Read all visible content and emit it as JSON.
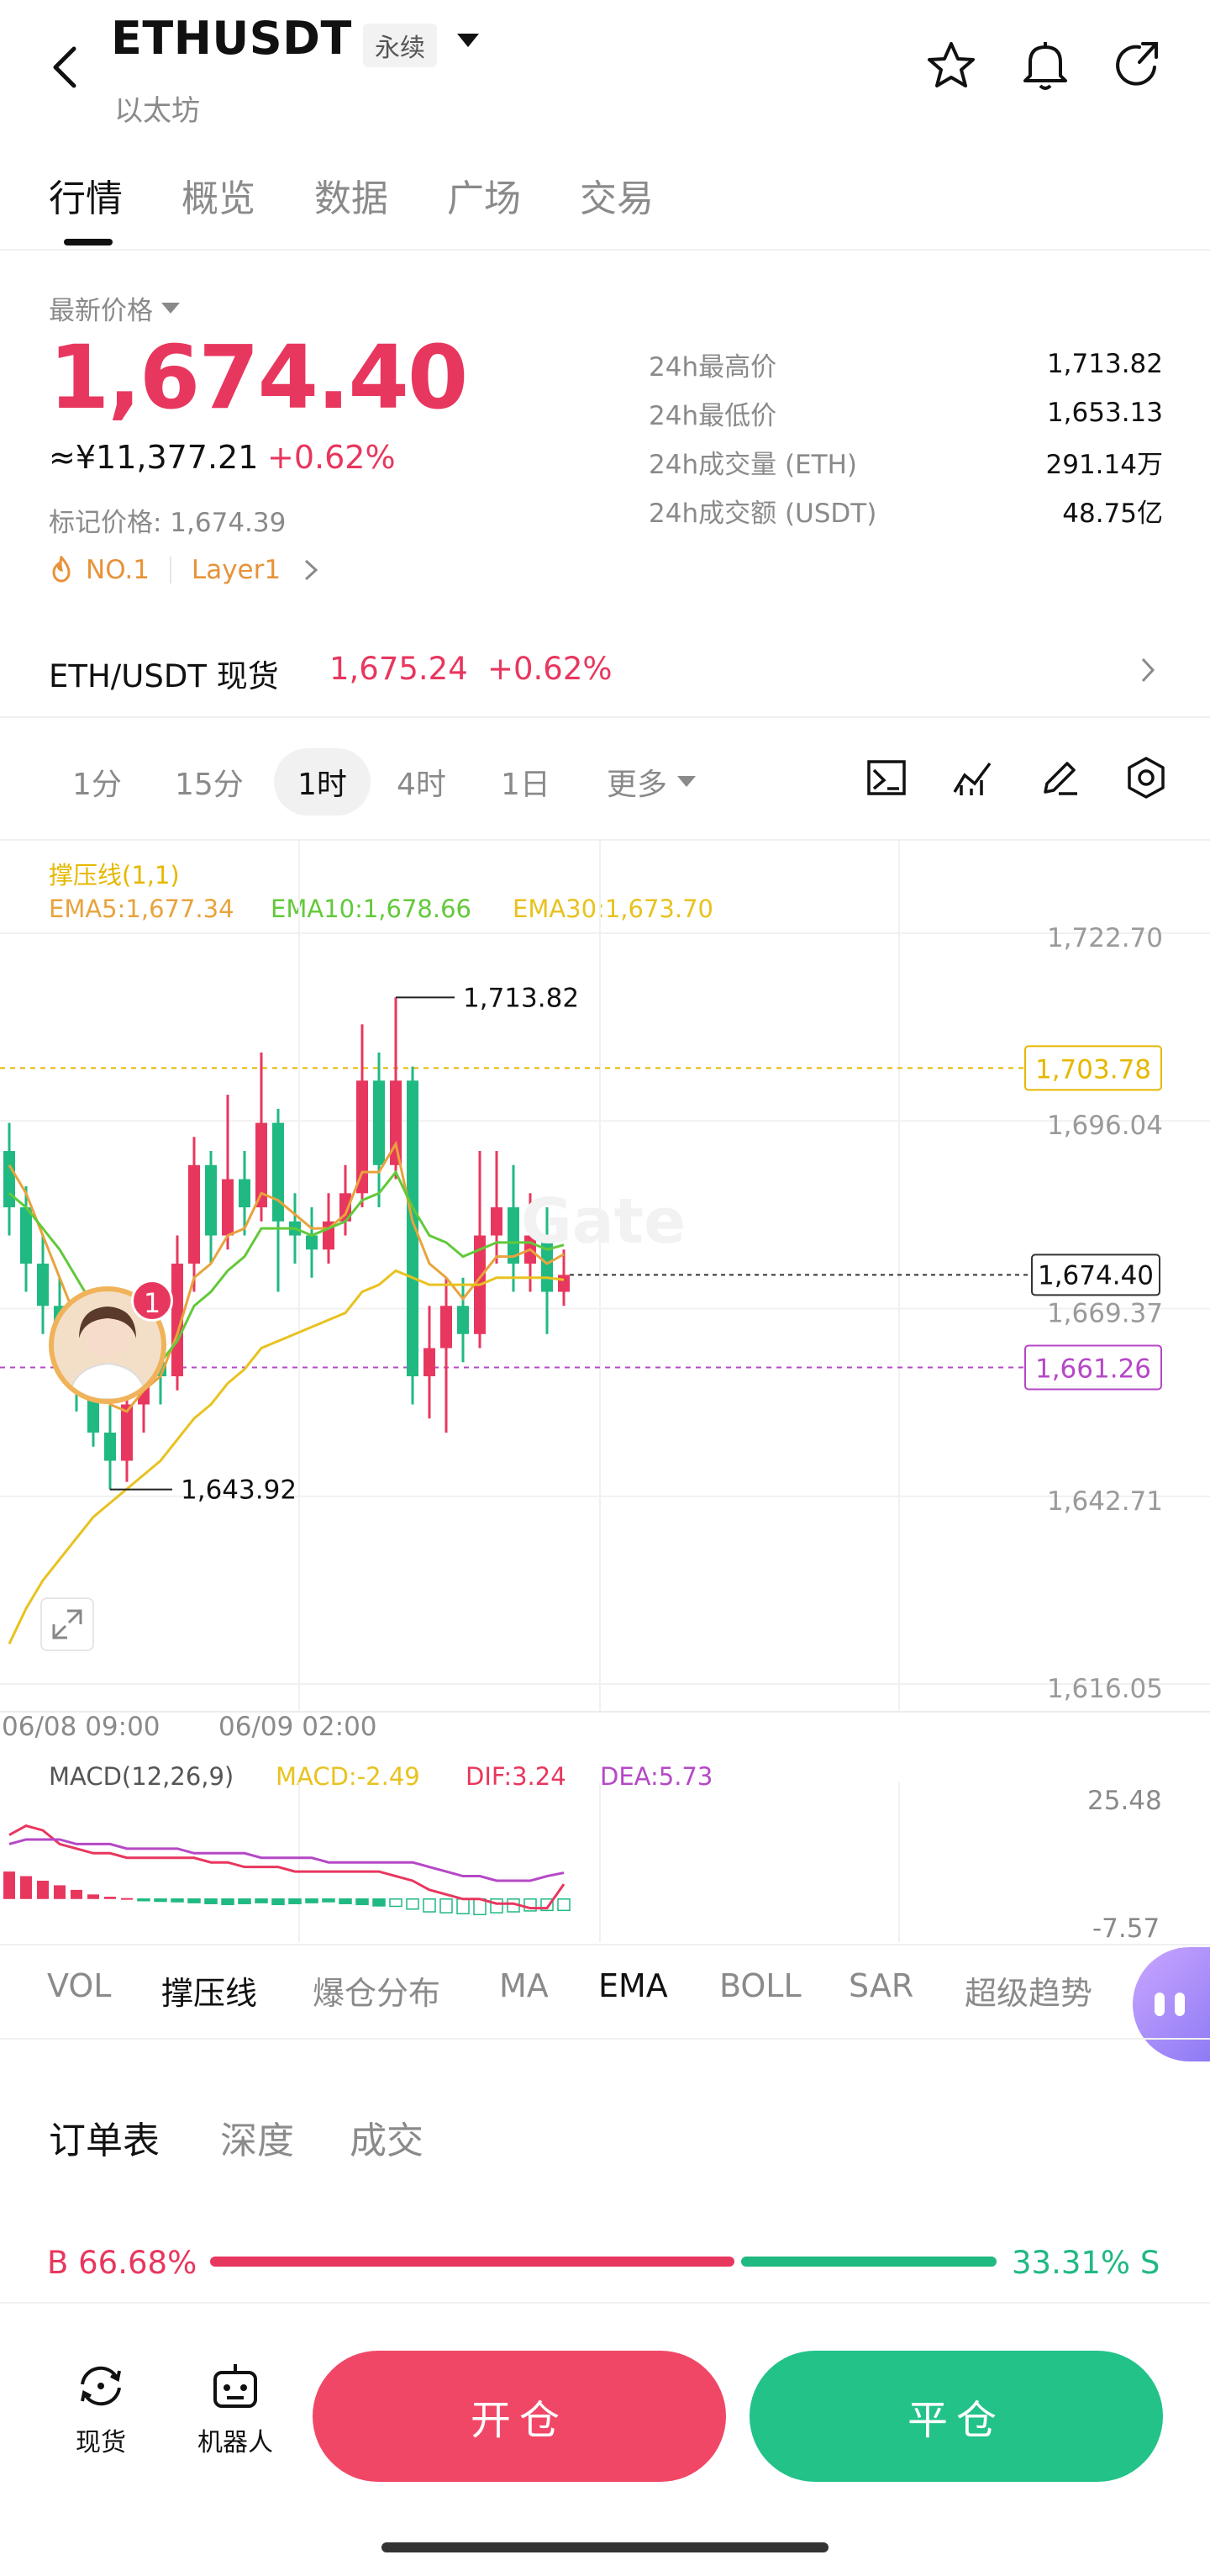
{
  "header": {
    "symbol": "ETHUSDT",
    "contract_tag": "永续",
    "subtitle": "以太坊"
  },
  "tabs": [
    {
      "label": "行情",
      "active": true
    },
    {
      "label": "概览",
      "active": false
    },
    {
      "label": "数据",
      "active": false
    },
    {
      "label": "广场",
      "active": false
    },
    {
      "label": "交易",
      "active": false
    }
  ],
  "price": {
    "label": "最新价格",
    "last": "1,674.40",
    "cny": "≈¥11,377.21",
    "change": "+0.62%",
    "mark_price": "标记价格: 1,674.39",
    "badge_rank": "NO.1",
    "badge_category": "Layer1"
  },
  "stats": [
    {
      "label": "24h最高价",
      "value": "1,713.82"
    },
    {
      "label": "24h最低价",
      "value": "1,653.13"
    },
    {
      "label": "24h成交量 (ETH)",
      "value": "291.14万"
    },
    {
      "label": "24h成交额 (USDT)",
      "value": "48.75亿"
    }
  ],
  "spot": {
    "pair": "ETH/USDT 现货",
    "price": "1,675.24",
    "change": "+0.62%"
  },
  "intervals": [
    {
      "label": "1分",
      "active": false
    },
    {
      "label": "15分",
      "active": false
    },
    {
      "label": "1时",
      "active": true
    },
    {
      "label": "4时",
      "active": false
    },
    {
      "label": "1日",
      "active": false
    },
    {
      "label": "更多",
      "active": false
    }
  ],
  "indicators_legend": {
    "support_line": "撑压线(1,1)",
    "ema5": "EMA5:1,677.34",
    "ema10": "EMA10:1,678.66",
    "ema30": "EMA30:1,673.70"
  },
  "colors": {
    "up": "#e8375e",
    "down": "#20b982",
    "ema5": "#e8a33d",
    "ema10": "#62c93a",
    "ema30": "#e8c21f",
    "support": "#e8a33d",
    "resistance_label": "#e6b800",
    "purple": "#b548c6"
  },
  "chart_data": {
    "type": "line",
    "title": "",
    "y_ticks": [
      "1,722.70",
      "1,696.04",
      "1,669.37",
      "1,642.71",
      "1,616.05"
    ],
    "ylim": [
      1616.05,
      1722.7
    ],
    "x_ticks": [
      "06/08 09:00",
      "06/09 02:00"
    ],
    "annotations": {
      "high": "1,713.82",
      "low": "1,643.92",
      "last": "1,674.40",
      "resistance": "1,703.78",
      "support": "1,661.26"
    },
    "candles": [
      [
        1692,
        1684,
        1696,
        1680
      ],
      [
        1684,
        1676,
        1687,
        1672
      ],
      [
        1676,
        1670,
        1680,
        1666
      ],
      [
        1670,
        1664,
        1674,
        1660
      ],
      [
        1664,
        1660,
        1668,
        1655
      ],
      [
        1660,
        1652,
        1664,
        1650
      ],
      [
        1652,
        1648,
        1656,
        1644
      ],
      [
        1648,
        1656,
        1660,
        1645
      ],
      [
        1656,
        1662,
        1665,
        1652
      ],
      [
        1662,
        1660,
        1666,
        1656
      ],
      [
        1660,
        1676,
        1680,
        1658
      ],
      [
        1676,
        1690,
        1694,
        1672
      ],
      [
        1690,
        1680,
        1692,
        1676
      ],
      [
        1680,
        1688,
        1700,
        1678
      ],
      [
        1688,
        1684,
        1692,
        1680
      ],
      [
        1684,
        1696,
        1706,
        1682
      ],
      [
        1696,
        1682,
        1698,
        1672
      ],
      [
        1682,
        1680,
        1686,
        1676
      ],
      [
        1680,
        1678,
        1684,
        1674
      ],
      [
        1678,
        1682,
        1686,
        1676
      ],
      [
        1682,
        1686,
        1690,
        1680
      ],
      [
        1686,
        1702,
        1710,
        1684
      ],
      [
        1702,
        1690,
        1706,
        1684
      ],
      [
        1690,
        1702,
        1713.82,
        1688
      ],
      [
        1702,
        1660,
        1704,
        1656
      ],
      [
        1660,
        1664,
        1670,
        1654
      ],
      [
        1664,
        1670,
        1674,
        1652
      ],
      [
        1670,
        1666,
        1674,
        1662
      ],
      [
        1666,
        1680,
        1692,
        1664
      ],
      [
        1680,
        1684,
        1692,
        1676
      ],
      [
        1684,
        1676,
        1690,
        1672
      ],
      [
        1676,
        1680,
        1686,
        1672
      ],
      [
        1680,
        1672,
        1684,
        1666
      ],
      [
        1672,
        1674.4,
        1678,
        1670
      ]
    ],
    "series": [
      {
        "name": "EMA5",
        "values": [
          1690,
          1686,
          1680,
          1674,
          1668,
          1662,
          1656,
          1655,
          1658,
          1660,
          1666,
          1674,
          1676,
          1680,
          1681,
          1686,
          1685,
          1683,
          1681,
          1681,
          1683,
          1689,
          1689,
          1693,
          1682,
          1676,
          1674,
          1671,
          1674,
          1677,
          1677,
          1678,
          1676,
          1677.34
        ]
      },
      {
        "name": "EMA10",
        "values": [
          1686,
          1684,
          1681,
          1678,
          1674,
          1670,
          1666,
          1664,
          1663,
          1662,
          1665,
          1670,
          1672,
          1675,
          1677,
          1681,
          1681,
          1681,
          1680,
          1681,
          1682,
          1685,
          1686,
          1689,
          1684,
          1680,
          1679,
          1677,
          1678,
          1679,
          1679,
          1679,
          1678,
          1678.66
        ]
      },
      {
        "name": "EMA30",
        "values": [
          1622,
          1627,
          1631,
          1634,
          1637,
          1640,
          1642,
          1644,
          1646,
          1648,
          1651,
          1654,
          1656,
          1659,
          1661,
          1664,
          1665,
          1666,
          1667,
          1668,
          1669,
          1672,
          1673,
          1675,
          1674,
          1673,
          1673,
          1673,
          1673,
          1674,
          1674,
          1674,
          1674,
          1673.7
        ]
      }
    ]
  },
  "macd": {
    "legend": {
      "name": "MACD(12,26,9)",
      "macd": "MACD:-2.49",
      "dif": "DIF:3.24",
      "dea": "DEA:5.73"
    },
    "y_ticks": [
      "25.48",
      "-7.57"
    ],
    "ylim": [
      -7.57,
      25.48
    ],
    "dif": [
      14,
      16,
      15,
      12,
      11,
      10,
      10,
      9,
      9,
      9,
      9,
      9,
      8,
      8,
      7,
      7,
      7,
      6,
      6,
      6,
      6,
      6,
      6,
      5,
      4,
      2,
      1,
      0,
      0,
      -1,
      -1,
      -2,
      -2,
      3.24
    ],
    "dea": [
      12,
      13,
      13,
      13,
      12,
      12,
      12,
      11,
      11,
      11,
      11,
      10,
      10,
      10,
      10,
      9,
      9,
      9,
      9,
      8,
      8,
      8,
      8,
      8,
      8,
      7,
      6,
      5,
      5,
      4,
      4,
      4,
      5,
      5.73
    ],
    "hist": [
      6,
      5,
      4,
      3,
      2,
      1,
      0.5,
      0.2,
      -0.3,
      -0.5,
      -0.6,
      -0.8,
      -1,
      -1.2,
      -1,
      -0.8,
      -1.2,
      -1,
      -0.8,
      -0.6,
      -1,
      -1.2,
      -1.5,
      -1.6,
      -2.2,
      -2.8,
      -3,
      -3.2,
      -3.4,
      -3,
      -2.8,
      -2.6,
      -2.5,
      -2.49
    ]
  },
  "indicator_tabs": [
    {
      "label": "VOL",
      "active": false
    },
    {
      "label": "撑压线",
      "active": true
    },
    {
      "label": "爆仓分布",
      "active": false
    },
    {
      "label": "MA",
      "active": false
    },
    {
      "label": "EMA",
      "active": true
    },
    {
      "label": "BOLL",
      "active": false
    },
    {
      "label": "SAR",
      "active": false
    },
    {
      "label": "超级趋势",
      "active": false
    }
  ],
  "orderbook_tabs": [
    {
      "label": "订单表",
      "active": true
    },
    {
      "label": "深度",
      "active": false
    },
    {
      "label": "成交",
      "active": false
    }
  ],
  "ratio": {
    "buy": "B 66.68%",
    "sell": "33.31% S",
    "buy_fraction": 0.6668
  },
  "bottom": {
    "spot_label": "现货",
    "bot_label": "机器人",
    "open_label": "开仓",
    "close_label": "平仓"
  },
  "avatar_badge": "1"
}
